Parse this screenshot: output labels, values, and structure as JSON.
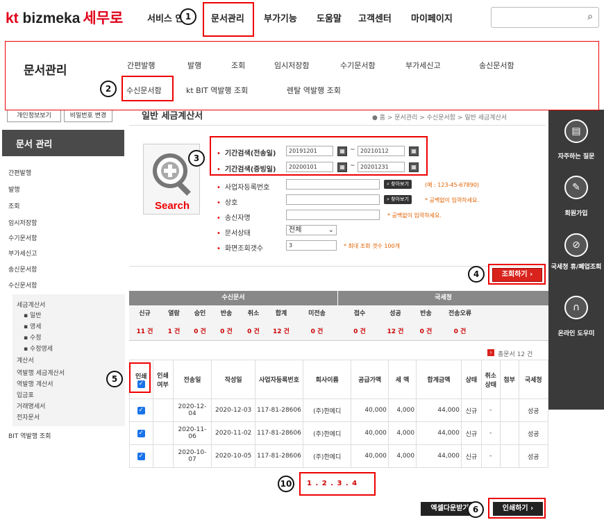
{
  "header": {
    "logo_kt": "kt",
    "logo_brand": "bizmeka",
    "logo_service": "세무로",
    "nav": [
      "서비스 안",
      "문서관리",
      "부가기능",
      "도움말",
      "고객센터",
      "마이페이지"
    ],
    "search_placeholder": ""
  },
  "callouts": [
    "1",
    "2",
    "3",
    "4",
    "5",
    "6",
    "10"
  ],
  "dropdown": {
    "title": "문서관리",
    "row1": [
      "간편발행",
      "발행",
      "조회",
      "임시저장함",
      "수기문서함",
      "부가세신고",
      "송신문서함"
    ],
    "row2": [
      "수신문서함",
      "kt BIT 역발행 조회",
      "렌탈 역발행 조회"
    ]
  },
  "sidebar": {
    "btn_personal": "개인정보보기",
    "btn_password": "비밀번호 변경",
    "heading": "문서 관리",
    "items": [
      "간편발행",
      "발행",
      "조회",
      "임시저장함",
      "수기문서함",
      "부가세신고",
      "송신문서함",
      "수신문서함"
    ],
    "subitems": [
      "세금계산서",
      "▪ 일반",
      "▪ 영세",
      "▪ 수정",
      "▪ 수정영세",
      "계산서",
      "역발행 세금계산서",
      "역발행 계산서",
      "입금표",
      "거래명세서",
      "전자문서"
    ],
    "bit": "BIT 역발행 조회"
  },
  "page": {
    "title": "일반 세금계산서",
    "breadcrumb": "● 홈 > 문서관리 > 수신문서함 > 일반 세금계산서"
  },
  "search_box": {
    "label": "Search"
  },
  "form": {
    "period_send_label": "기간검색(전송일)",
    "period_send_from": "20191201",
    "period_send_to": "20210112",
    "period_issue_label": "기간검색(증빙일)",
    "period_issue_from": "20200101",
    "period_issue_to": "20201231",
    "tilde": "~",
    "bizno_label": "사업자등록번호",
    "bizno_note": "(예 : 123-45-67890)",
    "company_label": "상호",
    "company_note": "* 공백없이 입력하세요.",
    "sender_label": "송신자명",
    "sender_note": "* 공백없이 입력하세요.",
    "status_label": "문서상태",
    "status_value": "전체",
    "rows_label": "화면조회갯수",
    "rows_value": "3",
    "rows_note": "* 최대 조회 갯수 100개",
    "find_btn": "찾아보기"
  },
  "buttons": {
    "search": "조회하기 ›",
    "excel": "엑셀다운받기",
    "print": "인쇄하기 ›"
  },
  "summary": {
    "group_recv": "수신문서",
    "group_nts": "국세청",
    "headers": [
      "신규",
      "열람",
      "승인",
      "반송",
      "취소",
      "합계",
      "미전송",
      "접수",
      "성공",
      "반송",
      "전송오류"
    ],
    "values": [
      "11 건",
      "1 건",
      "0 건",
      "0 건",
      "0 건",
      "12 건",
      "0 건",
      "0 건",
      "12 건",
      "0 건",
      "0 건"
    ]
  },
  "total": "총문서 12 건",
  "table": {
    "headers": [
      "인쇄",
      "인쇄여부",
      "전송일",
      "작성일",
      "사업자등록번호",
      "회사이름",
      "공급가액",
      "세 액",
      "합계금액",
      "상태",
      "취소상태",
      "첨부",
      "국세청"
    ],
    "rows": [
      [
        "",
        "",
        "2020-12-04",
        "2020-12-03",
        "117-81-28606",
        "(주)한메디",
        "40,000",
        "4,000",
        "44,000",
        "신규",
        "-",
        "",
        "성공"
      ],
      [
        "",
        "",
        "2020-11-06",
        "2020-11-02",
        "117-81-28606",
        "(주)한메디",
        "40,000",
        "4,000",
        "44,000",
        "신규",
        "-",
        "",
        "성공"
      ],
      [
        "",
        "",
        "2020-10-07",
        "2020-10-05",
        "117-81-28606",
        "(주)한메디",
        "40,000",
        "4,000",
        "44,000",
        "신규",
        "-",
        "",
        "성공"
      ]
    ]
  },
  "pager": "1 . 2 . 3 . 4",
  "rightbar": [
    "자주하는 질문",
    "회원가입",
    "국세청 휴/폐업조회",
    "온라인 도우미"
  ],
  "colors": {
    "accent": "#d9231d",
    "brand_red": "#e0001a",
    "dark": "#3a3a3a"
  }
}
